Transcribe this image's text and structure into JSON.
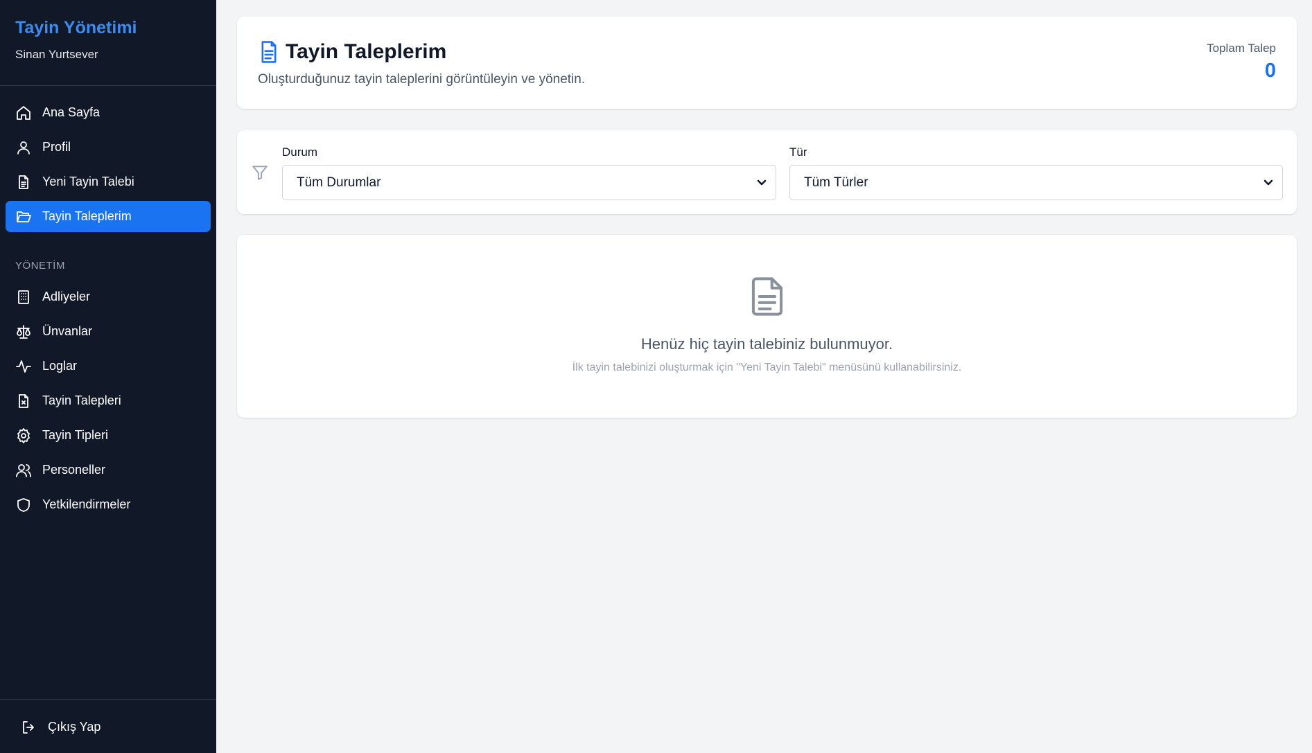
{
  "sidebar": {
    "brand_title": "Tayin Yönetimi",
    "user_name": "Sinan Yurtsever",
    "items": [
      {
        "label": "Ana Sayfa",
        "icon": "home-icon"
      },
      {
        "label": "Profil",
        "icon": "user-icon"
      },
      {
        "label": "Yeni Tayin Talebi",
        "icon": "document-icon"
      },
      {
        "label": "Tayin Taleplerim",
        "icon": "folder-open-icon",
        "active": true
      }
    ],
    "section_title": "YÖNETİM",
    "admin_items": [
      {
        "label": "Adliyeler",
        "icon": "building-icon"
      },
      {
        "label": "Ünvanlar",
        "icon": "scale-icon"
      },
      {
        "label": "Loglar",
        "icon": "activity-icon"
      },
      {
        "label": "Tayin Talepleri",
        "icon": "file-x-icon"
      },
      {
        "label": "Tayin Tipleri",
        "icon": "gear-icon"
      },
      {
        "label": "Personeller",
        "icon": "users-icon"
      },
      {
        "label": "Yetkilendirmeler",
        "icon": "shield-icon"
      }
    ],
    "logout_label": "Çıkış Yap"
  },
  "header": {
    "title": "Tayin Taleplerim",
    "subtitle": "Oluşturduğunuz tayin taleplerini görüntüleyin ve yönetin.",
    "total_label": "Toplam Talep",
    "total_value": "0"
  },
  "filters": {
    "status_label": "Durum",
    "status_selected": "Tüm Durumlar",
    "type_label": "Tür",
    "type_selected": "Tüm Türler"
  },
  "empty_state": {
    "title": "Henüz hiç tayin talebiniz bulunmuyor.",
    "subtitle": "İlk tayin talebinizi oluşturmak için \"Yeni Tayin Talebi\" menüsünü kullanabilirsiniz."
  },
  "colors": {
    "sidebar_bg": "#111827",
    "accent": "#1a73f0",
    "page_bg": "#f3f4f6"
  }
}
